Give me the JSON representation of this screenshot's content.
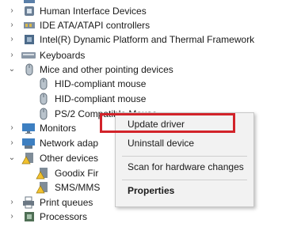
{
  "tree": {
    "items": [
      {
        "label": "",
        "chevron": "",
        "icon": "device-icon"
      },
      {
        "label": "Human Interface Devices",
        "chevron": ">",
        "icon": "hid-icon"
      },
      {
        "label": "IDE ATA/ATAPI controllers",
        "chevron": ">",
        "icon": "ide-controller-icon"
      },
      {
        "label": "Intel(R) Dynamic Platform and Thermal Framework",
        "chevron": ">",
        "icon": "chip-icon"
      },
      {
        "label": "Keyboards",
        "chevron": ">",
        "icon": "keyboard-icon"
      },
      {
        "label": "Mice and other pointing devices",
        "chevron": "v",
        "icon": "mouse-icon"
      },
      {
        "label": "HID-compliant mouse",
        "chevron": "",
        "icon": "mouse-icon"
      },
      {
        "label": "HID-compliant mouse",
        "chevron": "",
        "icon": "mouse-icon"
      },
      {
        "label": "PS/2 Compatible Mouse",
        "chevron": "",
        "icon": "mouse-icon"
      },
      {
        "label": "Monitors",
        "chevron": ">",
        "icon": "monitor-icon"
      },
      {
        "label": "Network adap",
        "chevron": ">",
        "icon": "network-icon"
      },
      {
        "label": "Other devices",
        "chevron": "v",
        "icon": "warning-device-icon"
      },
      {
        "label": "Goodix Fir",
        "chevron": "",
        "icon": "warning-device-icon"
      },
      {
        "label": "SMS/MMS",
        "chevron": "",
        "icon": "warning-device-icon"
      },
      {
        "label": "Print queues",
        "chevron": ">",
        "icon": "printer-icon"
      },
      {
        "label": "Processors",
        "chevron": ">",
        "icon": "processor-icon"
      }
    ]
  },
  "context_menu": {
    "update_driver": "Update driver",
    "uninstall_device": "Uninstall device",
    "scan_hardware": "Scan for hardware changes",
    "properties": "Properties"
  },
  "colors": {
    "highlight": "#d2232a",
    "menu_bg": "#f2f2f2"
  }
}
